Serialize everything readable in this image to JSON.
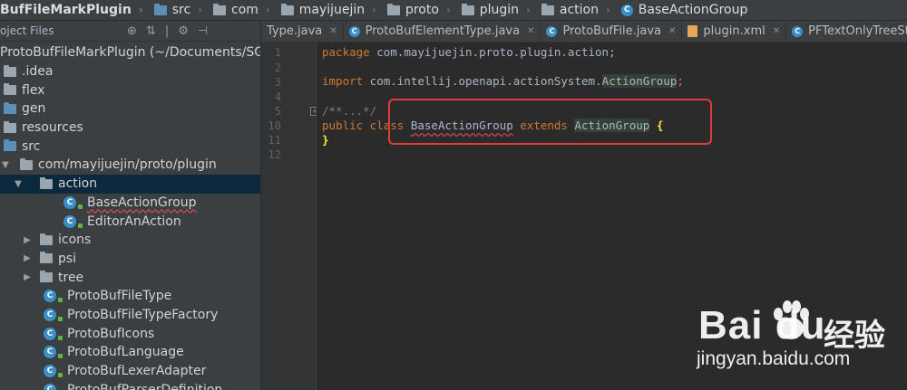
{
  "breadcrumb": {
    "project": "BufFileMarkPlugin",
    "items": [
      "src",
      "com",
      "mayijuejin",
      "proto",
      "plugin",
      "action",
      "BaseActionGroup"
    ]
  },
  "sidebar": {
    "view_label": "oject Files",
    "root": "ProtoBufFileMarkPlugin (~/Documents/SGO",
    "items": [
      {
        "label": ".idea"
      },
      {
        "label": "flex"
      },
      {
        "label": "gen"
      },
      {
        "label": "resources"
      },
      {
        "label": "src"
      },
      {
        "label": "com/mayijuejin/proto/plugin"
      },
      {
        "label": "action"
      },
      {
        "label": "BaseActionGroup"
      },
      {
        "label": "EditorAnAction"
      },
      {
        "label": "icons"
      },
      {
        "label": "psi"
      },
      {
        "label": "tree"
      },
      {
        "label": "ProtoBufFileType"
      },
      {
        "label": "ProtoBufFileTypeFactory"
      },
      {
        "label": "ProtoBufIcons"
      },
      {
        "label": "ProtoBufLanguage"
      },
      {
        "label": "ProtoBufLexerAdapter"
      },
      {
        "label": "ProtoBufParserDefinition"
      }
    ]
  },
  "tabs": [
    {
      "label": "Type.java"
    },
    {
      "label": "ProtoBufElementType.java"
    },
    {
      "label": "ProtoBufFile.java"
    },
    {
      "label": "plugin.xml"
    },
    {
      "label": "PFTextOnlyTreeStructureP"
    }
  ],
  "editor": {
    "line_numbers": [
      "1",
      "2",
      "3",
      "4",
      "5",
      "10",
      "11",
      "12"
    ],
    "l1_kw": "package",
    "l1_rest": " com.mayijuejin.proto.plugin.action;",
    "l3_kw": "import",
    "l3_rest": " com.intellij.openapi.actionSystem.",
    "l3_type": "ActionGroup",
    "l3_end": ";",
    "l5": "/**...*/",
    "l10_kw1": "public class",
    "l10_cls": "BaseActionGroup",
    "l10_kw2": "extends",
    "l10_type": "ActionGroup",
    "l10_brace": "{",
    "l11": "}"
  },
  "watermark": {
    "brand": "Bai du",
    "cn": "经验",
    "url": "jingyan.baidu.com"
  }
}
